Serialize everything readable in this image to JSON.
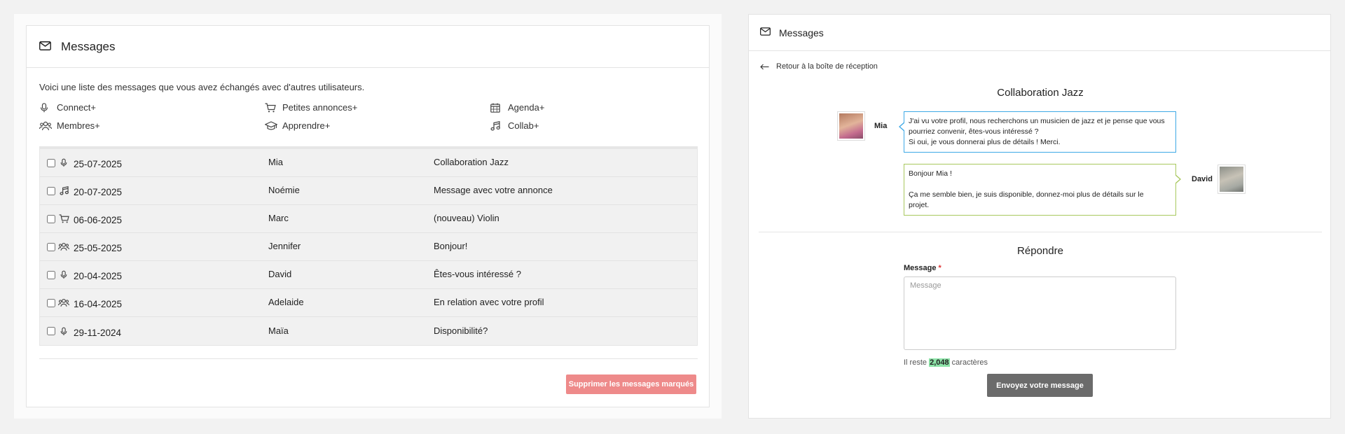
{
  "inbox": {
    "title": "Messages",
    "intro": "Voici une liste des messages que vous avez échangés avec d'autres utilisateurs.",
    "categories": [
      {
        "label": "Connect+",
        "icon": "microphone-icon"
      },
      {
        "label": "Petites annonces+",
        "icon": "cart-icon"
      },
      {
        "label": "Agenda+",
        "icon": "calendar-icon"
      },
      {
        "label": "Membres+",
        "icon": "users-icon"
      },
      {
        "label": "Apprendre+",
        "icon": "graduation-cap-icon"
      },
      {
        "label": "Collab+",
        "icon": "music-note-icon"
      }
    ],
    "rows": [
      {
        "date": "25-07-2025",
        "sender": "Mia",
        "subject": "Collaboration Jazz",
        "icon": "microphone-icon"
      },
      {
        "date": "20-07-2025",
        "sender": "Noémie",
        "subject": "Message avec votre annonce",
        "icon": "music-note-icon"
      },
      {
        "date": "06-06-2025",
        "sender": "Marc",
        "subject": "(nouveau) Violin",
        "icon": "cart-icon"
      },
      {
        "date": "25-05-2025",
        "sender": "Jennifer",
        "subject": "Bonjour!",
        "icon": "users-icon"
      },
      {
        "date": "20-04-2025",
        "sender": "David",
        "subject": "Êtes-vous intéressé ?",
        "icon": "microphone-icon"
      },
      {
        "date": "16-04-2025",
        "sender": "Adelaide",
        "subject": "En relation avec votre profil",
        "icon": "users-icon"
      },
      {
        "date": "29-11-2024",
        "sender": "Maïa",
        "subject": "Disponibilité?",
        "icon": "microphone-icon"
      }
    ],
    "delete_label": "Supprimer les messages marqués"
  },
  "conversation": {
    "header_title": "Messages",
    "back_label": "Retour à la boîte de réception",
    "title": "Collaboration Jazz",
    "messages": [
      {
        "author": "Mia",
        "lines": [
          "J'ai vu votre profil, nous recherchons un musicien de jazz et je pense que vous",
          "pourriez convenir, êtes-vous intéressé ?",
          "Si oui, je vous donnerai plus de détails ! Merci."
        ]
      },
      {
        "author": "David",
        "lines": [
          "Bonjour Mia !",
          "Ça me semble bien, je suis disponible, donnez-moi plus de détails sur le",
          "projet."
        ]
      }
    ],
    "reply_title": "Répondre",
    "message_label": "Message",
    "required_mark": "*",
    "message_placeholder": "Message",
    "remaining_prefix": "Il reste",
    "remaining_count": "2,048",
    "remaining_suffix": "caractères",
    "send_label": "Envoyez votre message"
  },
  "colors": {
    "delete_button": "#ee8a8a",
    "send_button": "#6b6b6b",
    "mia_bubble_border": "#3ea9e6",
    "david_bubble_border": "#a8c85e",
    "counter_highlight": "#8de3a8"
  }
}
